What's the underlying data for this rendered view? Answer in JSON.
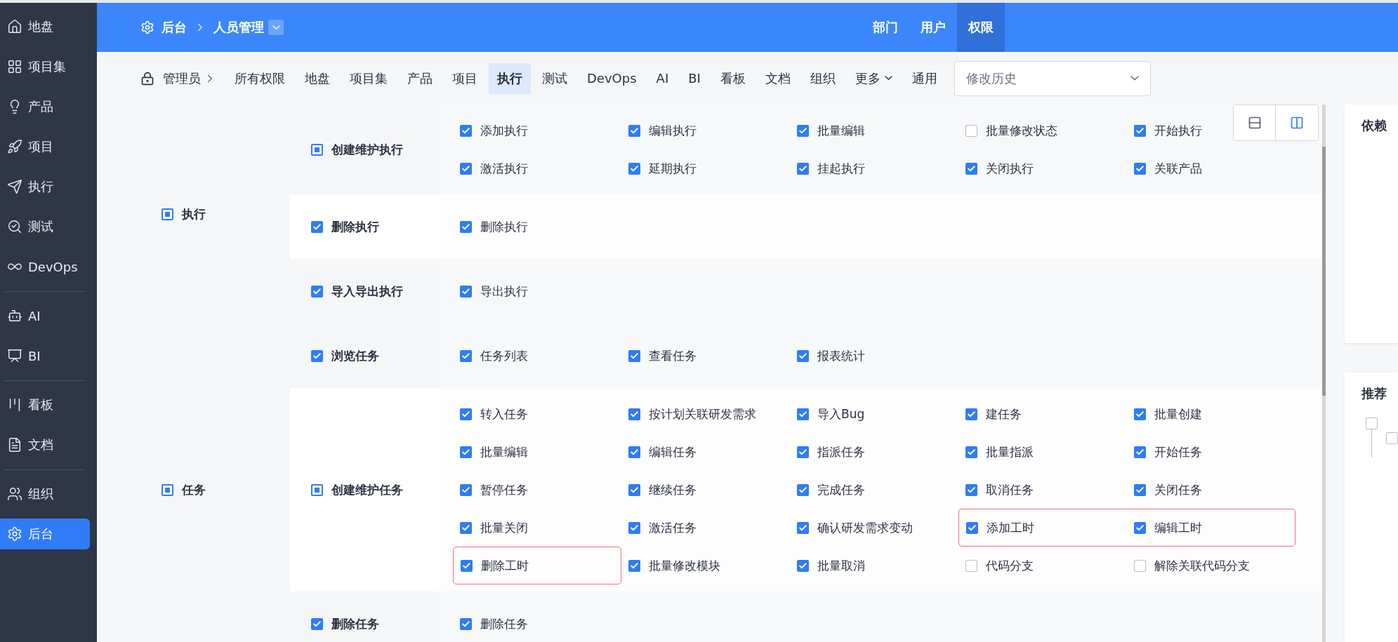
{
  "sidebar": {
    "sections": [
      [
        {
          "label": "地盘",
          "selected": false
        },
        {
          "label": "项目集",
          "selected": false
        },
        {
          "label": "产品",
          "selected": false
        },
        {
          "label": "项目",
          "selected": false
        },
        {
          "label": "执行",
          "selected": false
        },
        {
          "label": "测试",
          "selected": false
        },
        {
          "label": "DevOps",
          "selected": false
        }
      ],
      [
        {
          "label": "AI",
          "selected": false
        },
        {
          "label": "BI",
          "selected": false
        }
      ],
      [
        {
          "label": "看板",
          "selected": false
        },
        {
          "label": "文档",
          "selected": false
        }
      ],
      [
        {
          "label": "组织",
          "selected": false
        },
        {
          "label": "后台",
          "selected": true
        }
      ]
    ]
  },
  "header": {
    "breadcrumb": [
      "后台",
      "人员管理"
    ],
    "nav": [
      {
        "label": "部门",
        "selected": false
      },
      {
        "label": "用户",
        "selected": false
      },
      {
        "label": "权限",
        "selected": true
      }
    ]
  },
  "tab_bar": {
    "role": "管理员",
    "tabs": [
      {
        "label": "所有权限",
        "selected": false,
        "kind": "tab"
      },
      {
        "label": "地盘",
        "selected": false,
        "kind": "tab"
      },
      {
        "label": "项目集",
        "selected": false,
        "kind": "tab"
      },
      {
        "label": "产品",
        "selected": false,
        "kind": "tab"
      },
      {
        "label": "项目",
        "selected": false,
        "kind": "tab"
      },
      {
        "label": "执行",
        "selected": true,
        "kind": "tab"
      },
      {
        "label": "测试",
        "selected": false,
        "kind": "tab"
      },
      {
        "label": "DevOps",
        "selected": false,
        "kind": "tab"
      },
      {
        "label": "AI",
        "selected": false,
        "kind": "tab"
      },
      {
        "label": "BI",
        "selected": false,
        "kind": "tab"
      },
      {
        "label": "看板",
        "selected": false,
        "kind": "tab"
      },
      {
        "label": "文档",
        "selected": false,
        "kind": "tab"
      },
      {
        "label": "组织",
        "selected": false,
        "kind": "tab"
      },
      {
        "label": "更多",
        "selected": false,
        "kind": "menu"
      },
      {
        "label": "通用",
        "selected": false,
        "kind": "tab"
      }
    ],
    "history_select": {
      "value": "修改历史"
    }
  },
  "view_toggle": [
    {
      "selected": false
    },
    {
      "selected": true
    }
  ],
  "groups": [
    {
      "label": "执行",
      "indeterminate": true,
      "subs": [
        {
          "label": "创建维护执行",
          "indeterminate": true,
          "items": [
            {
              "label": "添加执行",
              "checked": true,
              "highlighted": false
            },
            {
              "label": "编辑执行",
              "checked": true,
              "highlighted": false
            },
            {
              "label": "批量编辑",
              "checked": true,
              "highlighted": false
            },
            {
              "label": "批量修改状态",
              "checked": false,
              "highlighted": false
            },
            {
              "label": "开始执行",
              "checked": true,
              "highlighted": false
            },
            {
              "label": "激活执行",
              "checked": true,
              "highlighted": false
            },
            {
              "label": "延期执行",
              "checked": true,
              "highlighted": false
            },
            {
              "label": "挂起执行",
              "checked": true,
              "highlighted": false
            },
            {
              "label": "关闭执行",
              "checked": true,
              "highlighted": false
            },
            {
              "label": "关联产品",
              "checked": true,
              "highlighted": false
            }
          ]
        },
        {
          "label": "删除执行",
          "checked": true,
          "items": [
            {
              "label": "删除执行",
              "checked": true,
              "highlighted": false
            }
          ]
        },
        {
          "label": "导入导出执行",
          "checked": true,
          "items": [
            {
              "label": "导出执行",
              "checked": true,
              "highlighted": false
            }
          ]
        }
      ]
    },
    {
      "label": "任务",
      "indeterminate": true,
      "subs": [
        {
          "label": "浏览任务",
          "checked": true,
          "items": [
            {
              "label": "任务列表",
              "checked": true,
              "highlighted": false
            },
            {
              "label": "查看任务",
              "checked": true,
              "highlighted": false
            },
            {
              "label": "报表统计",
              "checked": true,
              "highlighted": false
            }
          ]
        },
        {
          "label": "创建维护任务",
          "indeterminate": true,
          "items": [
            {
              "label": "转入任务",
              "checked": true,
              "highlighted": false
            },
            {
              "label": "按计划关联研发需求",
              "checked": true,
              "highlighted": false
            },
            {
              "label": "导入Bug",
              "checked": true,
              "highlighted": false
            },
            {
              "label": "建任务",
              "checked": true,
              "highlighted": false
            },
            {
              "label": "批量创建",
              "checked": true,
              "highlighted": false
            },
            {
              "label": "批量编辑",
              "checked": true,
              "highlighted": false
            },
            {
              "label": "编辑任务",
              "checked": true,
              "highlighted": false
            },
            {
              "label": "指派任务",
              "checked": true,
              "highlighted": false
            },
            {
              "label": "批量指派",
              "checked": true,
              "highlighted": false
            },
            {
              "label": "开始任务",
              "checked": true,
              "highlighted": false
            },
            {
              "label": "暂停任务",
              "checked": true,
              "highlighted": false
            },
            {
              "label": "继续任务",
              "checked": true,
              "highlighted": false
            },
            {
              "label": "完成任务",
              "checked": true,
              "highlighted": false
            },
            {
              "label": "取消任务",
              "checked": true,
              "highlighted": false
            },
            {
              "label": "关闭任务",
              "checked": true,
              "highlighted": false
            },
            {
              "label": "批量关闭",
              "checked": true,
              "highlighted": false
            },
            {
              "label": "激活任务",
              "checked": true,
              "highlighted": false
            },
            {
              "label": "确认研发需求变动",
              "checked": true,
              "highlighted": false
            },
            {
              "label": "添加工时",
              "checked": true,
              "highlighted": true
            },
            {
              "label": "编辑工时",
              "checked": true,
              "highlighted": true
            },
            {
              "label": "删除工时",
              "checked": true,
              "highlighted": true
            },
            {
              "label": "批量修改模块",
              "checked": true,
              "highlighted": false
            },
            {
              "label": "批量取消",
              "checked": true,
              "highlighted": false
            },
            {
              "label": "代码分支",
              "checked": false,
              "highlighted": false
            },
            {
              "label": "解除关联代码分支",
              "checked": false,
              "highlighted": false
            }
          ]
        },
        {
          "label": "删除任务",
          "checked": true,
          "items": [
            {
              "label": "删除任务",
              "checked": true,
              "highlighted": false
            }
          ]
        }
      ]
    }
  ],
  "side_panels": [
    {
      "title": "依赖"
    },
    {
      "title": "推荐",
      "tree_checked": false,
      "child_checked": false
    }
  ]
}
